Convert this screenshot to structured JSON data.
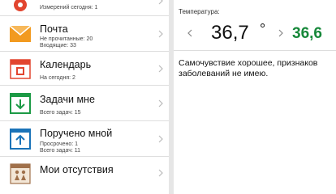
{
  "menu": {
    "top_partial": {
      "sub": "Измерений сегодня: 1"
    },
    "items": [
      {
        "title": "Почта",
        "sub1": "Не прочитанные: 20",
        "sub2": "Входящие: 33",
        "icon": "mail-icon"
      },
      {
        "title": "Календарь",
        "sub1": "На сегодня: 2",
        "icon": "calendar-icon"
      },
      {
        "title": "Задачи мне",
        "sub1": "Всего задач: 15",
        "icon": "tasks-inbox-icon"
      },
      {
        "title": "Поручено мной",
        "sub1": "Просрочено: 1",
        "sub2": "Всего задач: 11",
        "icon": "tasks-outbox-icon"
      },
      {
        "title": "Мои отсутствия",
        "icon": "absence-icon"
      }
    ]
  },
  "health": {
    "label": "Температура:",
    "value": "36,7",
    "degree": "°",
    "value_green": "36,6",
    "note": "Самочувствие хорошее, признаков заболеваний не имею."
  },
  "colors": {
    "green": "#17883a",
    "mail_orange": "#f29a1f",
    "calendar_red": "#e2452f",
    "tasks_green": "#1c9a45",
    "tasks_blue": "#1a73b8",
    "absence_brown": "#a0704a"
  }
}
